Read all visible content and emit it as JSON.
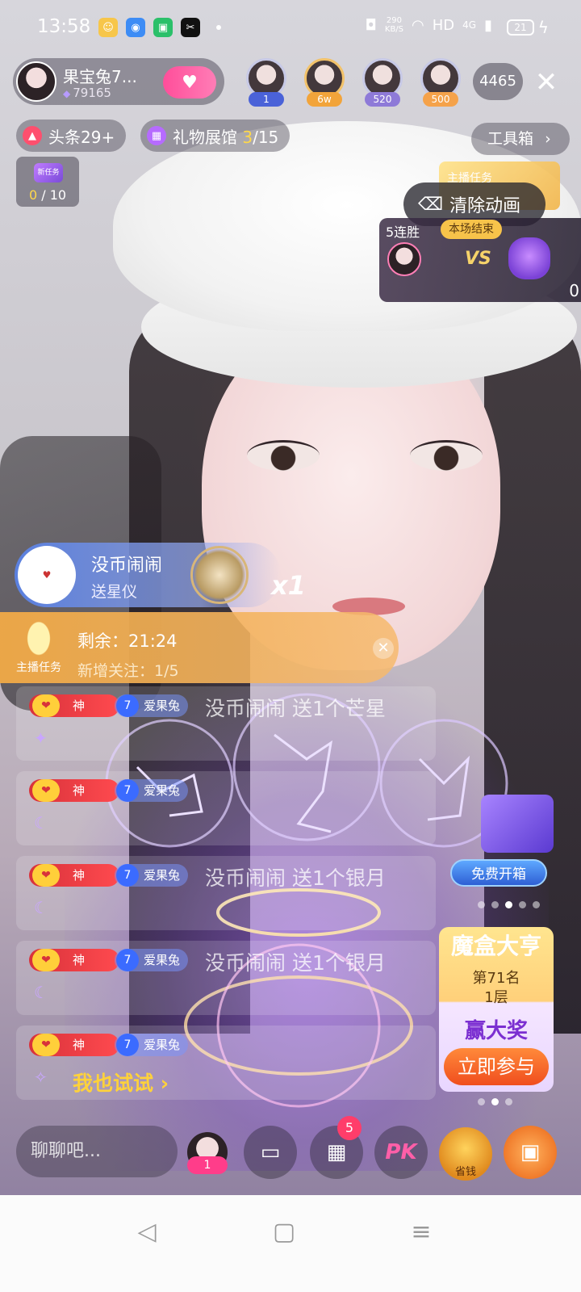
{
  "status_bar": {
    "time": "13:58",
    "net_speed_value": "290",
    "net_speed_unit": "KB/S",
    "hd": "HD",
    "signal": "4G",
    "battery": "21"
  },
  "host": {
    "name": "果宝兔7...",
    "fans": "79165"
  },
  "viewers": [
    {
      "badge": "1",
      "badge_color": "#4a62d8"
    },
    {
      "badge": "6w",
      "badge_color": "#f2a43a"
    },
    {
      "badge": "520",
      "badge_color": "#8e7ad8"
    },
    {
      "badge": "500",
      "badge_color": "#f5a24a"
    }
  ],
  "viewer_count": "4465",
  "headline_pill": {
    "label": "头条29+"
  },
  "gift_hall": {
    "label": "礼物展馆 ",
    "current": "3",
    "total": "/15"
  },
  "toolbox": {
    "label": "工具箱"
  },
  "task_mini": {
    "box_label": "新任务",
    "current": "0",
    "total": " / 10"
  },
  "anchor_task_top": {
    "label": "主播任务"
  },
  "clear_animation": {
    "label": "清除动画"
  },
  "pk": {
    "streak": "5连胜",
    "status": "本场结束",
    "vs": "VS",
    "score": "0"
  },
  "gift_banner": {
    "user": "没币闹闹",
    "desc": "送星仪",
    "multiplier": "x1"
  },
  "anchor_banner": {
    "badge": "主播任务",
    "remaining": "剩余：21:24",
    "new_follow": "新增关注：1/5"
  },
  "chat": [
    {
      "level": "神",
      "fan": "爱果兔",
      "text": "没币闹闹 送1个芒星"
    },
    {
      "level": "神",
      "fan": "爱果兔",
      "text": ""
    },
    {
      "level": "神",
      "fan": "爱果兔",
      "text": "没币闹闹 送1个银月"
    },
    {
      "level": "神",
      "fan": "爱果兔",
      "text": "没币闹闹 送1个银月"
    },
    {
      "level": "神",
      "fan": "爱果兔",
      "text": ""
    }
  ],
  "try_label": "我也试试",
  "chest": {
    "button": "免费开箱"
  },
  "mohe": {
    "title": "魔盒大亨",
    "rank": "第71名",
    "floor": "1层",
    "win": "赢大奖",
    "button": "立即参与"
  },
  "bottom": {
    "chat_placeholder": "聊聊吧...",
    "mic_badge": "1",
    "menu_badge": "5",
    "pk_label": "PK",
    "saving_label": "省钱"
  },
  "colors": {
    "accent_pink": "#ff4e9a",
    "task_orange": "#f2aa46",
    "level_red": "#d8323a",
    "highlight_yellow": "#ffd84a"
  }
}
